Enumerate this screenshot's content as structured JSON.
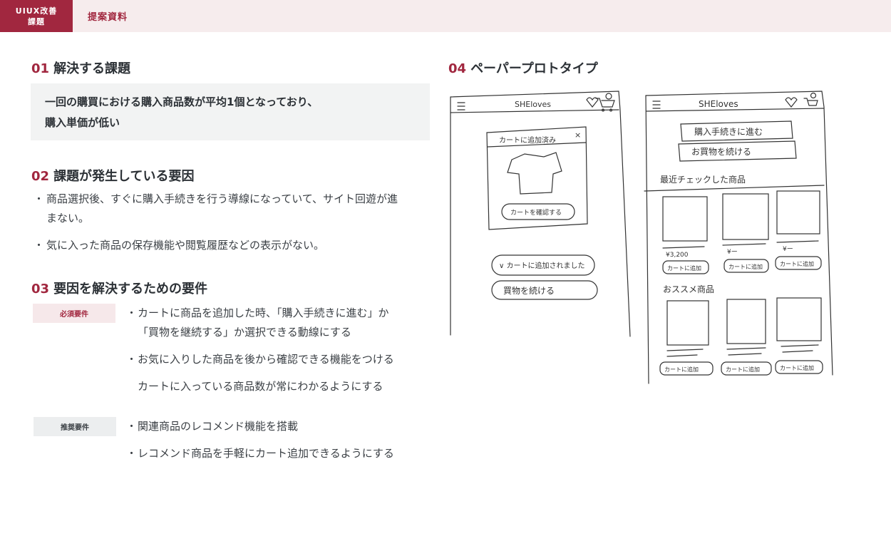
{
  "header": {
    "badge_line1": "UIUX改善",
    "badge_line2": "課題",
    "title": "提案資料"
  },
  "sections": {
    "s1": {
      "num": "01",
      "title": "解決する課題",
      "body_line1": "一回の購買における購入商品数が平均1個となっており、",
      "body_line2": "購入単価が低い"
    },
    "s2": {
      "num": "02",
      "title": "課題が発生している要因",
      "bullet_mark": "・",
      "items": [
        {
          "line1": "商品選択後、すぐに購入手続きを行う導線になっていて、サイト回遊が進",
          "line2": "まない。"
        },
        {
          "line1": "気に入った商品の保存機能や閲覧履歴などの表示がない。"
        }
      ]
    },
    "s3": {
      "num": "03",
      "title": "要因を解決するための要件",
      "bullet_mark": "・",
      "required_label": "必須要件",
      "required": [
        {
          "line1": "カートに商品を追加した時、「購入手続きに進む」か",
          "line2": "「買物を継続する」か選択できる動線にする"
        },
        {
          "line1": "お気に入りした商品を後から確認できる機能をつける",
          "line2": "カートに入っている商品数が常にわかるようにする"
        }
      ],
      "recommended_label": "推奨要件",
      "recommended": [
        "関連商品のレコメンド機能を搭載",
        "レコメンド商品を手軽にカート追加できるようにする"
      ]
    },
    "s4": {
      "num": "04",
      "title": "ペーパープロトタイプ"
    }
  },
  "sketch": {
    "left_phone": {
      "logo": "SHEloves",
      "modal_title": "カートに追加済み",
      "modal_close": "×",
      "modal_button": "カートを確認する",
      "added_button": "∨ カートに追加されました",
      "continue_button": "買物を続ける"
    },
    "right_phone": {
      "logo": "SHEloves",
      "checkout_button": "購入手続きに進む",
      "continue_button": "お買物を続ける",
      "recent_label": "最近チェックした商品",
      "prices": [
        "¥3,200",
        "¥ー",
        "¥ー"
      ],
      "add_to_cart": "カートに追加",
      "recommend_label": "おススメ商品"
    }
  }
}
